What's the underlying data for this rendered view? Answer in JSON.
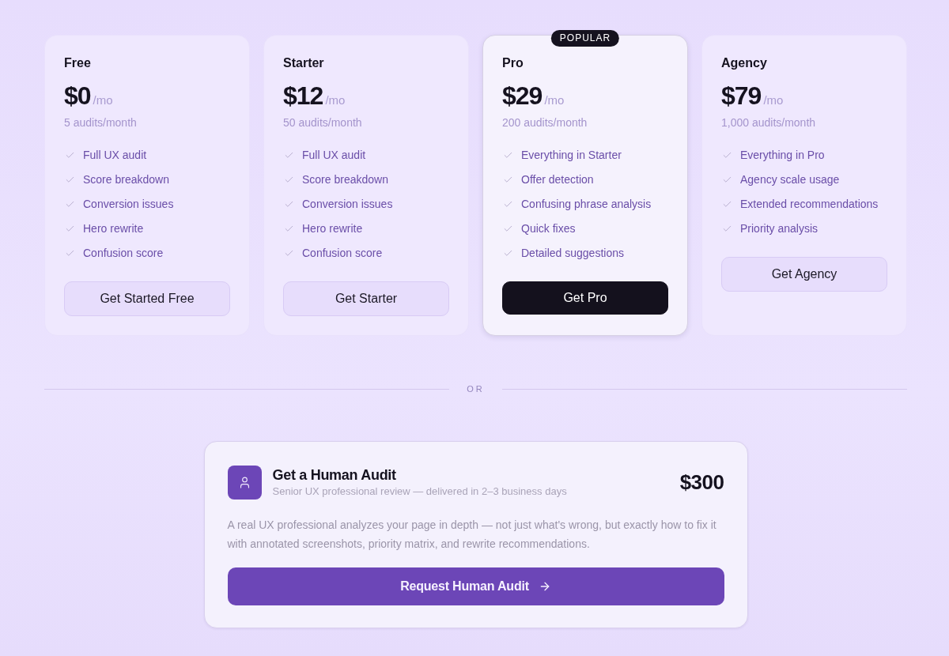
{
  "plans": [
    {
      "name": "Free",
      "price": "$0",
      "period": "/mo",
      "quota": "5 audits/month",
      "features": [
        "Full UX audit",
        "Score breakdown",
        "Conversion issues",
        "Hero rewrite",
        "Confusion score"
      ],
      "cta": "Get Started Free",
      "featured": false
    },
    {
      "name": "Starter",
      "price": "$12",
      "period": "/mo",
      "quota": "50 audits/month",
      "features": [
        "Full UX audit",
        "Score breakdown",
        "Conversion issues",
        "Hero rewrite",
        "Confusion score"
      ],
      "cta": "Get Starter",
      "featured": false
    },
    {
      "name": "Pro",
      "badge": "POPULAR",
      "price": "$29",
      "period": "/mo",
      "quota": "200 audits/month",
      "features": [
        "Everything in Starter",
        "Offer detection",
        "Confusing phrase analysis",
        "Quick fixes",
        "Detailed suggestions"
      ],
      "cta": "Get Pro",
      "featured": true
    },
    {
      "name": "Agency",
      "price": "$79",
      "period": "/mo",
      "quota": "1,000 audits/month",
      "features": [
        "Everything in Pro",
        "Agency scale usage",
        "Extended recommendations",
        "Priority analysis"
      ],
      "cta": "Get Agency",
      "featured": false
    }
  ],
  "divider": {
    "label": "OR"
  },
  "human_audit": {
    "title": "Get a Human Audit",
    "subtitle": "Senior UX professional review — delivered in 2–3 business days",
    "price": "$300",
    "description": "A real UX professional analyzes your page in depth — not just what's wrong, but exactly how to fix it with annotated screenshots, priority matrix, and rewrite recommendations.",
    "cta": "Request Human Audit"
  }
}
